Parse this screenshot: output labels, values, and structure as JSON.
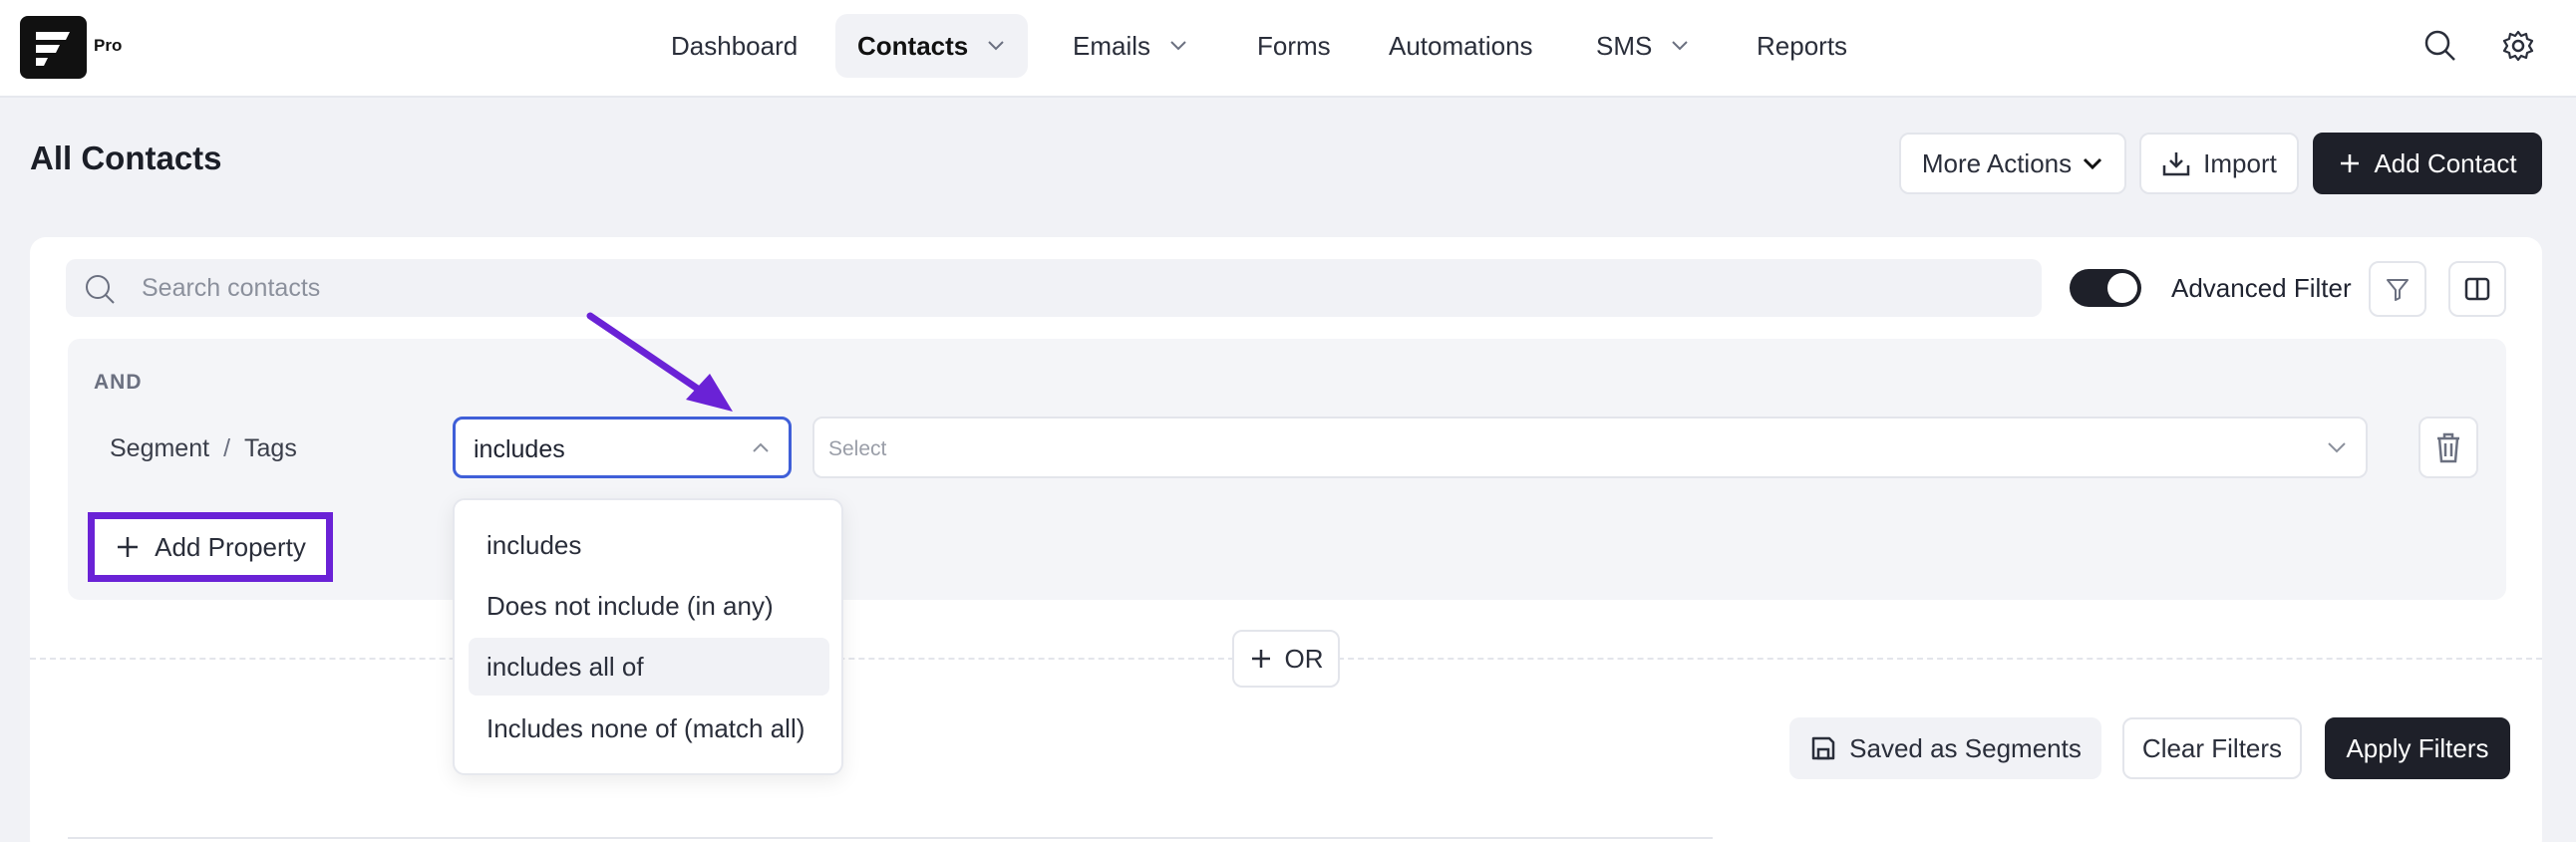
{
  "brand": {
    "badge": "Pro"
  },
  "nav": [
    {
      "label": "Dashboard"
    },
    {
      "label": "Contacts"
    },
    {
      "label": "Emails"
    },
    {
      "label": "Forms"
    },
    {
      "label": "Automations"
    },
    {
      "label": "SMS"
    },
    {
      "label": "Reports"
    }
  ],
  "page": {
    "title": "All Contacts"
  },
  "actions": {
    "more_actions": "More Actions",
    "import": "Import",
    "add_contact": "Add Contact"
  },
  "search": {
    "placeholder": "Search contacts"
  },
  "advanced_filter": {
    "label": "Advanced Filter",
    "enabled": true
  },
  "filter": {
    "group_label": "AND",
    "property": {
      "segment": "Segment",
      "separator": "/",
      "name": "Tags"
    },
    "operator_value": "includes",
    "value_placeholder": "Select",
    "add_property": "Add Property",
    "or_label": "OR"
  },
  "operator_options": [
    {
      "label": "includes"
    },
    {
      "label": "Does not include (in any)"
    },
    {
      "label": "includes all of",
      "highlighted": true
    },
    {
      "label": "Includes none of (match all)"
    }
  ],
  "footer_buttons": {
    "saved": "Saved as Segments",
    "clear": "Clear Filters",
    "apply": "Apply Filters"
  },
  "annotation": {
    "color": "#6a22d6"
  }
}
